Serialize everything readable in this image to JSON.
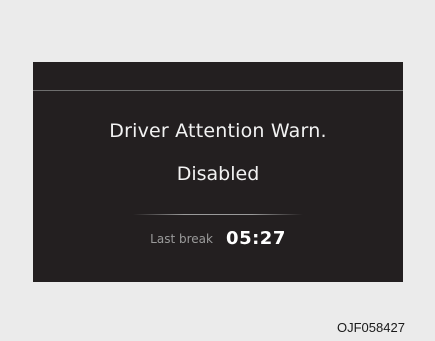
{
  "display": {
    "title": "Driver Attention Warn.",
    "status": "Disabled",
    "last_break_label": "Last break",
    "last_break_time": "05:27"
  },
  "figure_code": "OJF058427",
  "colors": {
    "panel_background": "#231f20",
    "page_background": "#ebebeb",
    "primary_text": "#f2f2f2",
    "secondary_text": "#9a9a9a"
  }
}
